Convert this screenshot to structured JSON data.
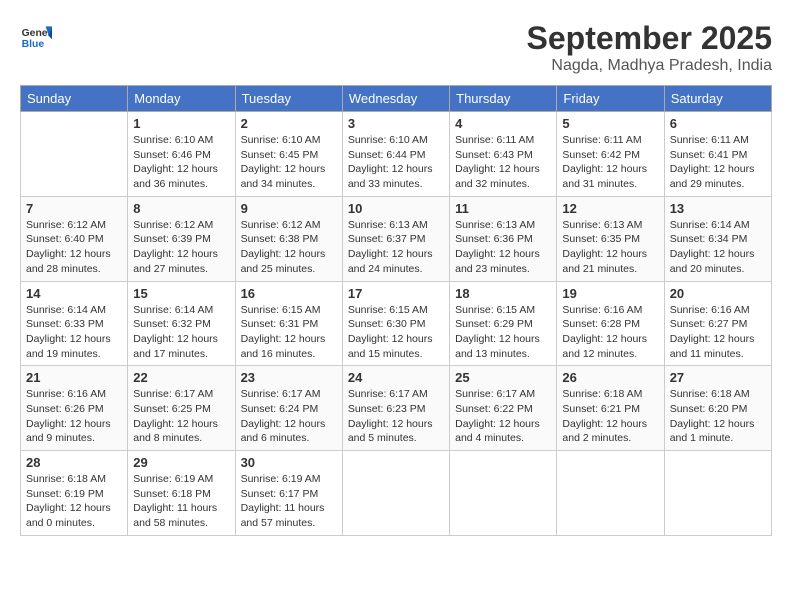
{
  "header": {
    "logo_general": "General",
    "logo_blue": "Blue",
    "month_title": "September 2025",
    "subtitle": "Nagda, Madhya Pradesh, India"
  },
  "days_of_week": [
    "Sunday",
    "Monday",
    "Tuesday",
    "Wednesday",
    "Thursday",
    "Friday",
    "Saturday"
  ],
  "weeks": [
    [
      {
        "day": "",
        "info": ""
      },
      {
        "day": "1",
        "info": "Sunrise: 6:10 AM\nSunset: 6:46 PM\nDaylight: 12 hours\nand 36 minutes."
      },
      {
        "day": "2",
        "info": "Sunrise: 6:10 AM\nSunset: 6:45 PM\nDaylight: 12 hours\nand 34 minutes."
      },
      {
        "day": "3",
        "info": "Sunrise: 6:10 AM\nSunset: 6:44 PM\nDaylight: 12 hours\nand 33 minutes."
      },
      {
        "day": "4",
        "info": "Sunrise: 6:11 AM\nSunset: 6:43 PM\nDaylight: 12 hours\nand 32 minutes."
      },
      {
        "day": "5",
        "info": "Sunrise: 6:11 AM\nSunset: 6:42 PM\nDaylight: 12 hours\nand 31 minutes."
      },
      {
        "day": "6",
        "info": "Sunrise: 6:11 AM\nSunset: 6:41 PM\nDaylight: 12 hours\nand 29 minutes."
      }
    ],
    [
      {
        "day": "7",
        "info": "Sunrise: 6:12 AM\nSunset: 6:40 PM\nDaylight: 12 hours\nand 28 minutes."
      },
      {
        "day": "8",
        "info": "Sunrise: 6:12 AM\nSunset: 6:39 PM\nDaylight: 12 hours\nand 27 minutes."
      },
      {
        "day": "9",
        "info": "Sunrise: 6:12 AM\nSunset: 6:38 PM\nDaylight: 12 hours\nand 25 minutes."
      },
      {
        "day": "10",
        "info": "Sunrise: 6:13 AM\nSunset: 6:37 PM\nDaylight: 12 hours\nand 24 minutes."
      },
      {
        "day": "11",
        "info": "Sunrise: 6:13 AM\nSunset: 6:36 PM\nDaylight: 12 hours\nand 23 minutes."
      },
      {
        "day": "12",
        "info": "Sunrise: 6:13 AM\nSunset: 6:35 PM\nDaylight: 12 hours\nand 21 minutes."
      },
      {
        "day": "13",
        "info": "Sunrise: 6:14 AM\nSunset: 6:34 PM\nDaylight: 12 hours\nand 20 minutes."
      }
    ],
    [
      {
        "day": "14",
        "info": "Sunrise: 6:14 AM\nSunset: 6:33 PM\nDaylight: 12 hours\nand 19 minutes."
      },
      {
        "day": "15",
        "info": "Sunrise: 6:14 AM\nSunset: 6:32 PM\nDaylight: 12 hours\nand 17 minutes."
      },
      {
        "day": "16",
        "info": "Sunrise: 6:15 AM\nSunset: 6:31 PM\nDaylight: 12 hours\nand 16 minutes."
      },
      {
        "day": "17",
        "info": "Sunrise: 6:15 AM\nSunset: 6:30 PM\nDaylight: 12 hours\nand 15 minutes."
      },
      {
        "day": "18",
        "info": "Sunrise: 6:15 AM\nSunset: 6:29 PM\nDaylight: 12 hours\nand 13 minutes."
      },
      {
        "day": "19",
        "info": "Sunrise: 6:16 AM\nSunset: 6:28 PM\nDaylight: 12 hours\nand 12 minutes."
      },
      {
        "day": "20",
        "info": "Sunrise: 6:16 AM\nSunset: 6:27 PM\nDaylight: 12 hours\nand 11 minutes."
      }
    ],
    [
      {
        "day": "21",
        "info": "Sunrise: 6:16 AM\nSunset: 6:26 PM\nDaylight: 12 hours\nand 9 minutes."
      },
      {
        "day": "22",
        "info": "Sunrise: 6:17 AM\nSunset: 6:25 PM\nDaylight: 12 hours\nand 8 minutes."
      },
      {
        "day": "23",
        "info": "Sunrise: 6:17 AM\nSunset: 6:24 PM\nDaylight: 12 hours\nand 6 minutes."
      },
      {
        "day": "24",
        "info": "Sunrise: 6:17 AM\nSunset: 6:23 PM\nDaylight: 12 hours\nand 5 minutes."
      },
      {
        "day": "25",
        "info": "Sunrise: 6:17 AM\nSunset: 6:22 PM\nDaylight: 12 hours\nand 4 minutes."
      },
      {
        "day": "26",
        "info": "Sunrise: 6:18 AM\nSunset: 6:21 PM\nDaylight: 12 hours\nand 2 minutes."
      },
      {
        "day": "27",
        "info": "Sunrise: 6:18 AM\nSunset: 6:20 PM\nDaylight: 12 hours\nand 1 minute."
      }
    ],
    [
      {
        "day": "28",
        "info": "Sunrise: 6:18 AM\nSunset: 6:19 PM\nDaylight: 12 hours\nand 0 minutes."
      },
      {
        "day": "29",
        "info": "Sunrise: 6:19 AM\nSunset: 6:18 PM\nDaylight: 11 hours\nand 58 minutes."
      },
      {
        "day": "30",
        "info": "Sunrise: 6:19 AM\nSunset: 6:17 PM\nDaylight: 11 hours\nand 57 minutes."
      },
      {
        "day": "",
        "info": ""
      },
      {
        "day": "",
        "info": ""
      },
      {
        "day": "",
        "info": ""
      },
      {
        "day": "",
        "info": ""
      }
    ]
  ]
}
